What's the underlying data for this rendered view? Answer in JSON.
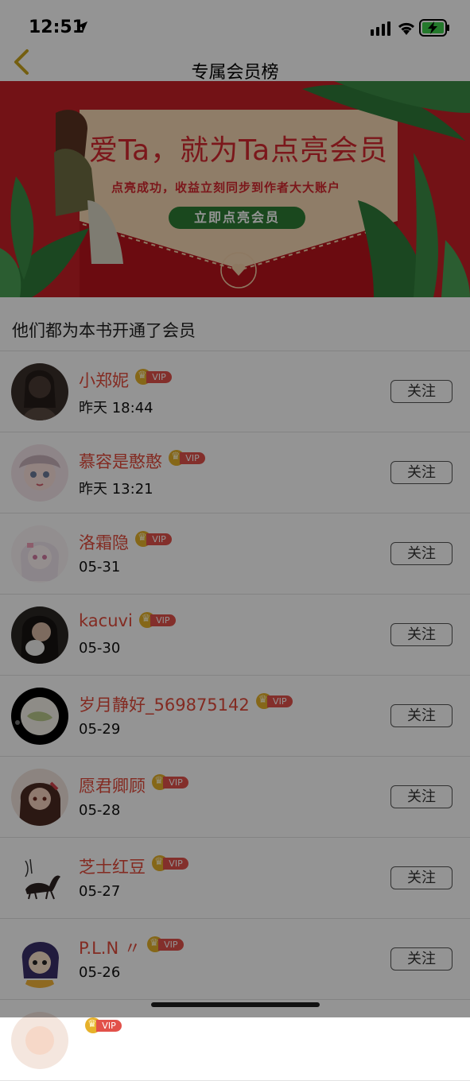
{
  "status_bar": {
    "time": "12:51"
  },
  "nav": {
    "title": "专属会员榜"
  },
  "banner": {
    "title": "爱Ta，就为Ta点亮会员",
    "subtitle": "点亮成功，收益立刻同步到作者大大账户",
    "button_label": "立即点亮会员"
  },
  "section": {
    "title": "他们都为本书开通了会员"
  },
  "vip_label": "VIP",
  "members": [
    {
      "name": "小郑妮",
      "time": "昨天 18:44",
      "follow": "关注"
    },
    {
      "name": "慕容是憨憨",
      "time": "昨天 13:21",
      "follow": "关注"
    },
    {
      "name": "洛霜隐",
      "time": "05-31",
      "follow": "关注"
    },
    {
      "name": "kacuvi",
      "time": "05-30",
      "follow": "关注"
    },
    {
      "name": "岁月静好_569875142",
      "time": "05-29",
      "follow": "关注"
    },
    {
      "name": "愿君卿顾",
      "time": "05-28",
      "follow": "关注"
    },
    {
      "name": "芝士红豆",
      "time": "05-27",
      "follow": "关注"
    },
    {
      "name": "P.L.N 〃",
      "time": "05-26",
      "follow": "关注"
    },
    {
      "name": "",
      "time": "",
      "follow": ""
    }
  ],
  "colors": {
    "accent_red": "#e24a3b",
    "vip_gold": "#e6b12a",
    "banner_red": "#c71f27",
    "banner_green": "#2e7d34"
  }
}
